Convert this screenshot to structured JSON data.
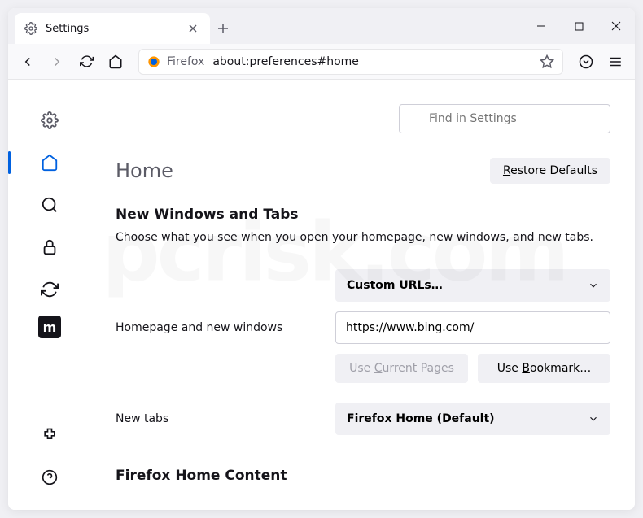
{
  "tab": {
    "title": "Settings"
  },
  "urlbar": {
    "prefix": "Firefox",
    "url": "about:preferences#home"
  },
  "search": {
    "placeholder": "Find in Settings"
  },
  "page": {
    "heading": "Home",
    "restore": "Restore Defaults",
    "section1_title": "New Windows and Tabs",
    "section1_desc": "Choose what you see when you open your homepage, new windows, and new tabs.",
    "homepage_label": "Homepage and new windows",
    "homepage_select": "Custom URLs…",
    "homepage_url": "https://www.bing.com/",
    "use_current": "Use Current Pages",
    "use_bookmark": "Use Bookmark…",
    "newtabs_label": "New tabs",
    "newtabs_select": "Firefox Home (Default)",
    "section2_title": "Firefox Home Content"
  },
  "sidebar": {
    "m_label": "m"
  },
  "watermark": "pcrisk.com"
}
